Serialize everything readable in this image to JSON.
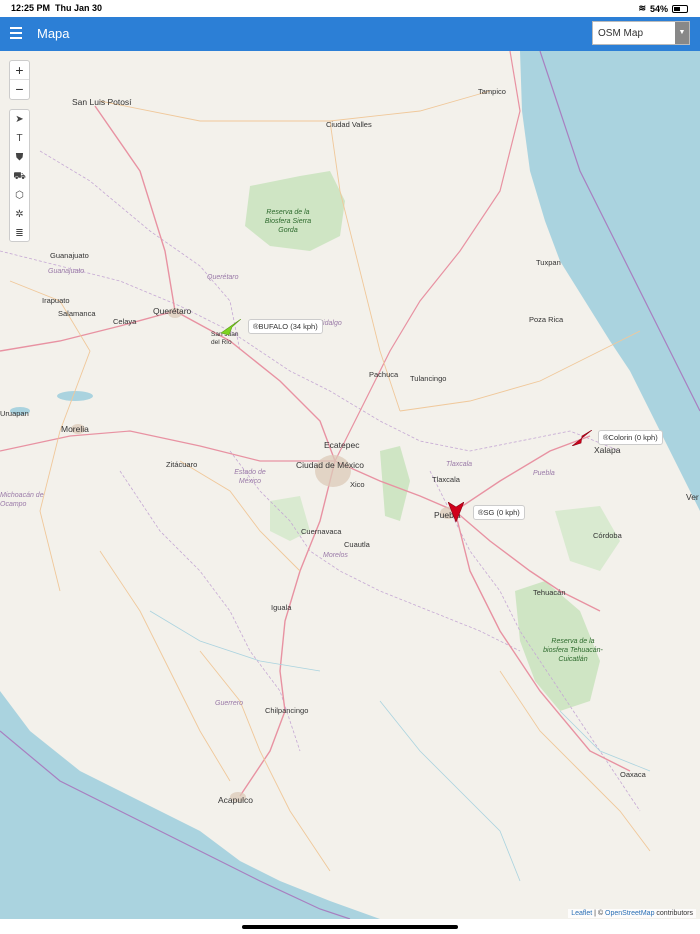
{
  "status": {
    "time": "12:25 PM",
    "date": "Thu Jan 30",
    "battery": "54%",
    "battery_fraction": 0.54
  },
  "header": {
    "title": "Mapa",
    "map_select": "OSM Map"
  },
  "zoom": {
    "in": "+",
    "out": "−"
  },
  "cities": [
    {
      "name": "San Luis Potosí",
      "big": true
    },
    {
      "name": "Tampico"
    },
    {
      "name": "Ciudad Valles"
    },
    {
      "name": "Guanajuato"
    },
    {
      "name": "Irapuato"
    },
    {
      "name": "Salamanca"
    },
    {
      "name": "Celaya"
    },
    {
      "name": "Querétaro",
      "big": true
    },
    {
      "name": "San Juan del Río"
    },
    {
      "name": "Pachuca"
    },
    {
      "name": "Tulancingo"
    },
    {
      "name": "Tuxpan"
    },
    {
      "name": "Poza Rica"
    },
    {
      "name": "Morelia",
      "big": true
    },
    {
      "name": "Zitácuaro"
    },
    {
      "name": "Ecatepec",
      "big": true
    },
    {
      "name": "Ciudad de México",
      "big": true
    },
    {
      "name": "Xico"
    },
    {
      "name": "Tlaxcala"
    },
    {
      "name": "Puebla",
      "big": true
    },
    {
      "name": "Xalapa",
      "big": true
    },
    {
      "name": "Córdoba"
    },
    {
      "name": "Tehuacán"
    },
    {
      "name": "Cuernavaca"
    },
    {
      "name": "Cuautla"
    },
    {
      "name": "Iguala"
    },
    {
      "name": "Chilpancingo"
    },
    {
      "name": "Acapulco",
      "big": true
    },
    {
      "name": "Oaxaca"
    },
    {
      "name": "Uruapan"
    },
    {
      "name": "Ver"
    }
  ],
  "regions": [
    "Guanajuato",
    "Querétaro",
    "Hidalgo",
    "Estado de México",
    "Michoacán de Ocampo",
    "Tlaxcala",
    "Puebla",
    "Morelos",
    "Guerrero"
  ],
  "reserves": [
    "Reserva de la Biosfera Sierra Gorda",
    "Reserva de la biosfera Tehuacán-Cuicatlán"
  ],
  "markers": [
    {
      "label": "®BUFALO (34 kph)",
      "color": "#7ed321"
    },
    {
      "label": "®Colorin (0 kph)",
      "color": "#d0021b"
    },
    {
      "label": "®SG (0 kph)",
      "color": "#d0021b"
    }
  ],
  "attribution": {
    "leaflet": "Leaflet",
    "sep": " | © ",
    "osm": "OpenStreetMap",
    "suffix": " contributors"
  },
  "colors": {
    "header": "#2c7fd6",
    "water": "#aad3df",
    "land": "#f3f1eb",
    "forest": "#cfe5c4"
  }
}
